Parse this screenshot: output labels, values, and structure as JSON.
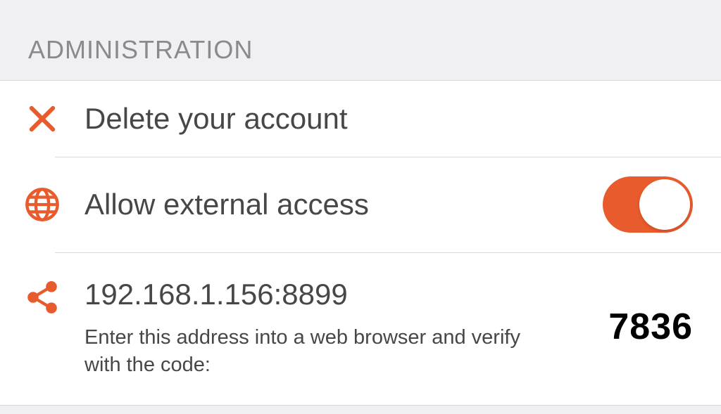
{
  "section": {
    "title": "ADMINISTRATION"
  },
  "rows": {
    "delete": {
      "label": "Delete your account"
    },
    "external": {
      "label": "Allow external access",
      "toggle_on": true
    },
    "address": {
      "value": "192.168.1.156:8899",
      "help": "Enter this address into a web browser and verify with the code:",
      "code": "7836"
    }
  },
  "colors": {
    "accent": "#e85b2c"
  }
}
